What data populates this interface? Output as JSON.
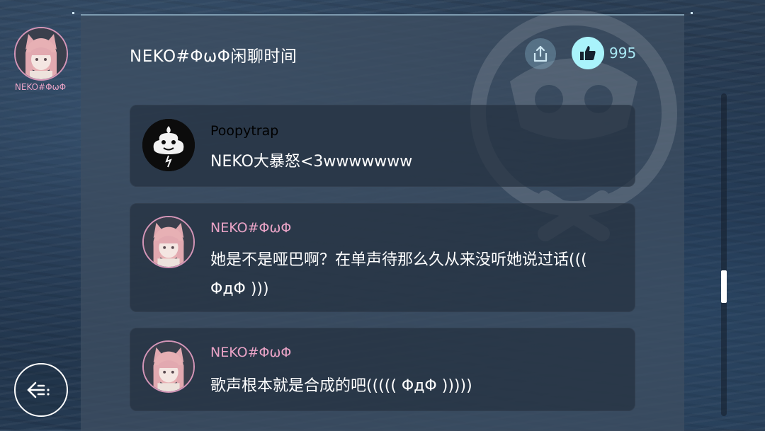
{
  "channel": {
    "name": "NEKO#ΦωΦ"
  },
  "header": {
    "title": "NEKO#ΦωΦ闲聊时间",
    "like_count": "995"
  },
  "messages": [
    {
      "username": "Poopytrap",
      "text": "NEKO大暴怒<3wwwwwww",
      "avatar": "poop-avatar",
      "name_color": "#ffffff"
    },
    {
      "username": "NEKO#ΦωΦ",
      "text": "她是不是哑巴啊？在单声待那么久从来没听她说过话((( ΦдΦ )))",
      "avatar": "neko-avatar",
      "name_color": "#e9a3c6"
    },
    {
      "username": "NEKO#ΦωΦ",
      "text": "歌声根本就是合成的吧((((( ΦдΦ )))))",
      "avatar": "neko-avatar",
      "name_color": "#e9a3c6"
    }
  ],
  "icons": {
    "share": "share-icon",
    "like": "thumbs-up-icon",
    "back": "back-arrow-icon"
  },
  "colors": {
    "accent_pink": "#e9a3c6",
    "like_bg": "#a9f3fb"
  }
}
